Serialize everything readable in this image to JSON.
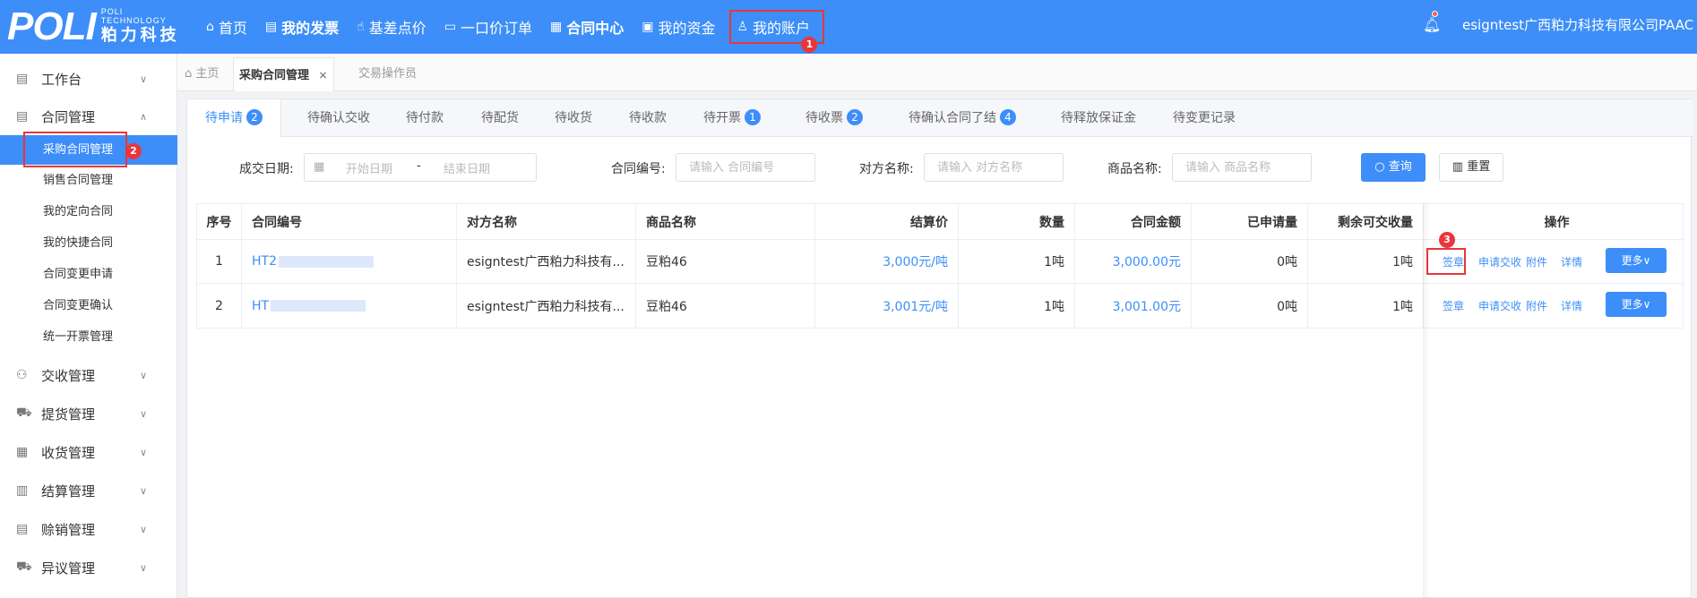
{
  "logo": {
    "mark": "POLI",
    "en_line1": "POLI",
    "en_line2": "TECHNOLOGY",
    "cn": "粕力科技"
  },
  "nav": [
    {
      "icon": "home-icon",
      "glyph": "⌂",
      "label": "首页"
    },
    {
      "icon": "invoice-icon",
      "glyph": "▤",
      "label": "我的发票"
    },
    {
      "icon": "hand-pointer-icon",
      "glyph": "☝",
      "label": "基差点价"
    },
    {
      "icon": "id-card-icon",
      "glyph": "▭",
      "label": "一口价订单"
    },
    {
      "icon": "document-icon",
      "glyph": "▦",
      "label": "合同中心"
    },
    {
      "icon": "wallet-icon",
      "glyph": "▣",
      "label": "我的资金"
    },
    {
      "icon": "user-icon",
      "glyph": "♙",
      "label": "我的账户"
    }
  ],
  "annotations": {
    "step1": "1",
    "step2": "2",
    "step3": "3"
  },
  "header": {
    "user": "esigntest广西粕力科技有限公司PAAC",
    "caret": "∨"
  },
  "sidebar": {
    "groups": [
      {
        "icon": "workbench-icon",
        "glyph": "▤",
        "label": "工作台",
        "chev": "∨"
      },
      {
        "icon": "contract-icon",
        "glyph": "▤",
        "label": "合同管理",
        "chev": "∧"
      },
      {
        "icon": "handover-icon",
        "glyph": "⚇",
        "label": "交收管理",
        "chev": "∨"
      },
      {
        "icon": "pickup-icon",
        "glyph": "⛟",
        "label": "提货管理",
        "chev": "∨"
      },
      {
        "icon": "receiving-icon",
        "glyph": "▦",
        "label": "收货管理",
        "chev": "∨"
      },
      {
        "icon": "settlement-icon",
        "glyph": "▥",
        "label": "结算管理",
        "chev": "∨"
      },
      {
        "icon": "credit-sale-icon",
        "glyph": "▤",
        "label": "赊销管理",
        "chev": "∨"
      },
      {
        "icon": "dispute-icon",
        "glyph": "⛟",
        "label": "异议管理",
        "chev": "∨"
      }
    ],
    "sub_items": [
      "采购合同管理",
      "销售合同管理",
      "我的定向合同",
      "我的快捷合同",
      "合同变更申请",
      "合同变更确认",
      "统一开票管理"
    ]
  },
  "page_tabs": {
    "home": "主页",
    "active": "采购合同管理",
    "close": "×",
    "other": "交易操作员"
  },
  "sub_tabs": [
    {
      "label": "待申请",
      "count": "2"
    },
    {
      "label": "待确认交收",
      "count": ""
    },
    {
      "label": "待付款",
      "count": ""
    },
    {
      "label": "待配货",
      "count": ""
    },
    {
      "label": "待收货",
      "count": ""
    },
    {
      "label": "待收款",
      "count": ""
    },
    {
      "label": "待开票",
      "count": "1"
    },
    {
      "label": "待收票",
      "count": "2"
    },
    {
      "label": "待确认合同了结",
      "count": "4"
    },
    {
      "label": "待释放保证金",
      "count": ""
    },
    {
      "label": "待变更记录",
      "count": ""
    }
  ],
  "filters": {
    "date_label": "成交日期:",
    "date_start": "开始日期",
    "date_sep": "-",
    "date_end": "结束日期",
    "contract_label": "合同编号:",
    "contract_placeholder": "请输入 合同编号",
    "party_label": "对方名称:",
    "party_placeholder": "请输入 对方名称",
    "product_label": "商品名称:",
    "product_placeholder": "请输入 商品名称",
    "search_btn": "查询",
    "reset_btn": "重置"
  },
  "table": {
    "headers": [
      "序号",
      "合同编号",
      "对方名称",
      "商品名称",
      "结算价",
      "数量",
      "合同金额",
      "已申请量",
      "剩余可交收量",
      "操作"
    ],
    "rows": [
      {
        "no": "1",
        "contract": "HT2",
        "party": "esigntest广西粕力科技有...",
        "product": "豆粕46",
        "price": "3,000元/吨",
        "qty": "1吨",
        "amount": "3,000.00元",
        "applied": "0吨",
        "remaining": "1吨"
      },
      {
        "no": "2",
        "contract": "HT",
        "party": "esigntest广西粕力科技有...",
        "product": "豆粕46",
        "price": "3,001元/吨",
        "qty": "1吨",
        "amount": "3,001.00元",
        "applied": "0吨",
        "remaining": "1吨"
      }
    ],
    "ops": {
      "sign": "签章",
      "apply": "申请交收",
      "attach": "附件",
      "detail": "详情",
      "more": "更多∨"
    }
  }
}
